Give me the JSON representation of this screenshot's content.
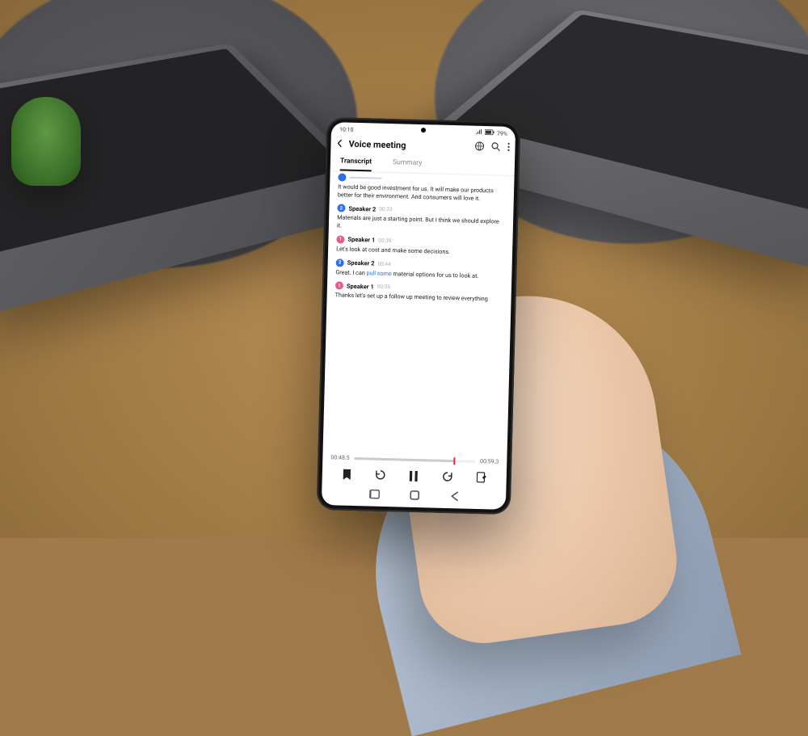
{
  "status": {
    "time": "10:10",
    "battery": "79%"
  },
  "header": {
    "title": "Voice meeting"
  },
  "tabs": {
    "transcript": "Transcript",
    "summary": "Summary"
  },
  "transcript": [
    {
      "speaker": "",
      "time": "",
      "avatar": "blue",
      "text": "It would be good investment for us. It will make our products better for their environment. And consumers will love it."
    },
    {
      "speaker": "Speaker 2",
      "time": "00:33",
      "avatar": "blue",
      "text": "Materials are just a starting point. But I think we should explore it."
    },
    {
      "speaker": "Speaker 1",
      "time": "00:39",
      "avatar": "pink",
      "text": "Let's look at cost and make some decisions."
    },
    {
      "speaker": "Speaker 2",
      "time": "00:44",
      "avatar": "blue",
      "text_pre": "Great. I can ",
      "text_link": "pull some",
      "text_post": " material options for us to look at."
    },
    {
      "speaker": "Speaker 1",
      "time": "00:55",
      "avatar": "pink",
      "text": "Thanks let's set up a follow up meeting to review everything"
    }
  ],
  "scrubber": {
    "current": "00:48.5",
    "total": "00:59.3"
  }
}
